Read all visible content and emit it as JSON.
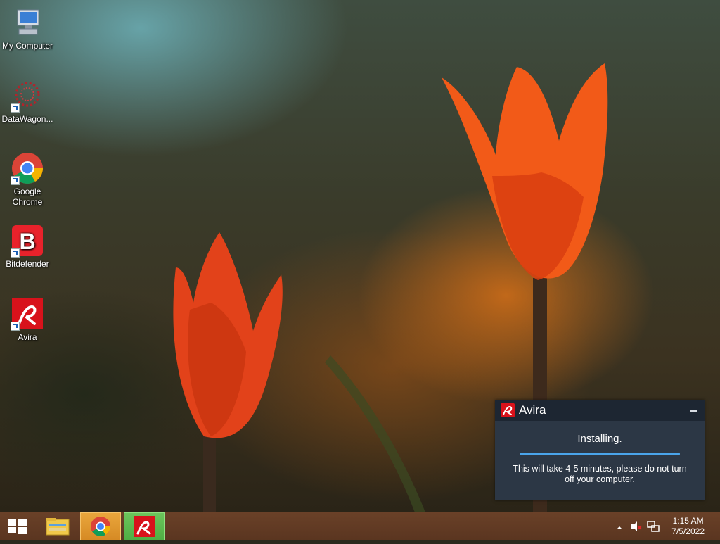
{
  "desktop": {
    "icons": [
      {
        "label": "My Computer",
        "icon": "computer-icon"
      },
      {
        "label": "DataWagon...",
        "icon": "datawagon-icon"
      },
      {
        "label": "Google Chrome",
        "icon": "chrome-icon"
      },
      {
        "label": "Bitdefender",
        "icon": "bitdefender-icon"
      },
      {
        "label": "Avira",
        "icon": "avira-icon"
      }
    ]
  },
  "toast": {
    "title": "Avira",
    "status": "Installing.",
    "message": "This will take 4-5 minutes, please do not turn off your computer.",
    "progress": 1.0,
    "accent": "#d8121b",
    "progress_color": "#4aa4ea"
  },
  "taskbar": {
    "pinned": [
      "start-icon",
      "file-explorer-icon",
      "chrome-icon",
      "avira-icon"
    ],
    "tray": [
      "show-hidden-icons-icon",
      "speaker-muted-icon",
      "network-icon"
    ],
    "clock": {
      "time": "1:15 AM",
      "date": "7/5/2022"
    }
  }
}
